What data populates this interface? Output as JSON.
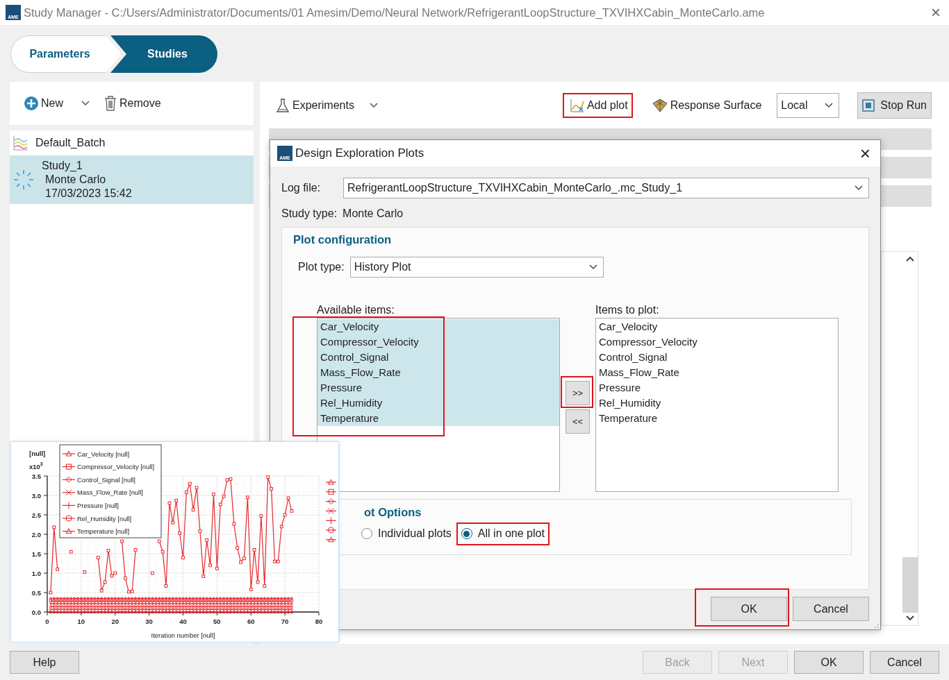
{
  "window": {
    "logo": "AME",
    "title": "Study Manager - C:/Users/Administrator/Documents/01 Amesim/Demo/Neural Network/RefrigerantLoopStructure_TXVIHXCabin_MonteCarlo.ame",
    "close": "×"
  },
  "breadcrumb": [
    {
      "label": "Parameters",
      "selected": false
    },
    {
      "label": "Studies",
      "selected": true
    }
  ],
  "left_toolbar": {
    "new": "New",
    "remove": "Remove"
  },
  "batch": {
    "name": "Default_Batch",
    "studies": [
      {
        "name": "Study_1",
        "type": "Monte Carlo",
        "date": "17/03/2023 15:42",
        "selected": true
      }
    ]
  },
  "right_toolbar": {
    "experiments": "Experiments",
    "add_plot": {
      "label": "Add plot",
      "highlighted": true
    },
    "response_surface": "Response Surface",
    "location": "Local",
    "stop_run": "Stop Run"
  },
  "dialog": {
    "logo": "AME",
    "title": "Design Exploration Plots",
    "close": "×",
    "log_file_label": "Log file:",
    "log_file": "RefrigerantLoopStructure_TXVIHXCabin_MonteCarlo_.mc_Study_1",
    "study_type_label": "Study type:",
    "study_type": "Monte Carlo",
    "plot_config_title": "Plot configuration",
    "plot_type_label": "Plot type:",
    "plot_type": "History Plot",
    "available_label": "Available items:",
    "available_highlighted": true,
    "available_items": [
      {
        "label": "Car_Velocity",
        "selected": true
      },
      {
        "label": "Compressor_Velocity",
        "selected": true
      },
      {
        "label": "Control_Signal",
        "selected": true
      },
      {
        "label": "Mass_Flow_Rate",
        "selected": true
      },
      {
        "label": "Pressure",
        "selected": true
      },
      {
        "label": "Rel_Humidity",
        "selected": true
      },
      {
        "label": "Temperature",
        "selected": true
      }
    ],
    "add_button": {
      "label": ">>",
      "highlighted": true
    },
    "remove_button": {
      "label": "<<"
    },
    "plot_label": "Items to plot:",
    "plot_items": [
      {
        "label": "Car_Velocity",
        "selected": false
      },
      {
        "label": "Compressor_Velocity",
        "selected": false
      },
      {
        "label": "Control_Signal",
        "selected": false
      },
      {
        "label": "Mass_Flow_Rate",
        "selected": false
      },
      {
        "label": "Pressure",
        "selected": false
      },
      {
        "label": "Rel_Humidity",
        "selected": false
      },
      {
        "label": "Temperature",
        "selected": false
      }
    ],
    "options_title": "ot Options",
    "options": [
      {
        "label": "Individual plots",
        "selected": false
      },
      {
        "label": "All in one plot",
        "selected": true,
        "highlighted": true
      }
    ],
    "ok": {
      "label": "OK",
      "highlighted": true
    },
    "cancel": {
      "label": "Cancel"
    }
  },
  "plot_preview": {
    "scale": "x10$^{3}$",
    "chart_data": {
      "type": "line",
      "grid": true,
      "legend": "upper left",
      "xlabel": "Iteration number [null]",
      "ylabel": "[null]",
      "xlim": [
        0,
        80
      ],
      "ylim": [
        0,
        3.5
      ],
      "xticks": [
        0,
        10,
        20,
        30,
        40,
        50,
        60,
        70,
        80
      ],
      "yticks": [
        {
          "value": 0,
          "label": "0.0"
        },
        {
          "value": 0.5,
          "label": "0.5"
        },
        {
          "value": 1,
          "label": "1.0"
        },
        {
          "value": 1.5,
          "label": "1.5"
        },
        {
          "value": 2,
          "label": "2.0"
        },
        {
          "value": 2.5,
          "label": "2.5"
        },
        {
          "value": 3,
          "label": "3.0"
        },
        {
          "value": 3.5,
          "label": "3.5"
        }
      ],
      "x": [
        1,
        2,
        3,
        4,
        5,
        6,
        7,
        8,
        9,
        10,
        11,
        12,
        13,
        14,
        15,
        16,
        17,
        18,
        19,
        20,
        21,
        22,
        23,
        24,
        25,
        26,
        27,
        28,
        29,
        30,
        31,
        32,
        33,
        34,
        35,
        36,
        37,
        38,
        39,
        40,
        41,
        42,
        43,
        44,
        45,
        46,
        47,
        48,
        49,
        50,
        51,
        52,
        53,
        54,
        55,
        56,
        57,
        58,
        59,
        60,
        61,
        62,
        63,
        64,
        65,
        66,
        67,
        68,
        69,
        70,
        71,
        72
      ],
      "series": [
        {
          "name": "Car_Velocity [null]",
          "color": "#e8262b",
          "marker": "triangle",
          "values": [
            0,
            0,
            0,
            0,
            0,
            0,
            0,
            0,
            0,
            0,
            0,
            0,
            0,
            0,
            0,
            0,
            0,
            0,
            0,
            0,
            0,
            0,
            0,
            0,
            0,
            0,
            0,
            0,
            0,
            0,
            0,
            0,
            0,
            0,
            0,
            0,
            0,
            0,
            0,
            0,
            0,
            0,
            0,
            0,
            0,
            0,
            0,
            0,
            0,
            0,
            0,
            0,
            0,
            0,
            0,
            0,
            0,
            0,
            0,
            0,
            0,
            0,
            0,
            0,
            0,
            0,
            0,
            0,
            0,
            0,
            0,
            0
          ]
        },
        {
          "name": "Compressor_Velocity [null]",
          "color": "#e8262b",
          "marker": "square",
          "values": [
            0.5,
            2.18,
            1.1,
            null,
            null,
            null,
            1.55,
            null,
            null,
            null,
            1.03,
            null,
            null,
            null,
            1.4,
            0.55,
            0.77,
            1.58,
            0.93,
            1.0,
            null,
            1.82,
            0.87,
            0.52,
            0.53,
            1.6,
            null,
            null,
            null,
            null,
            1.0,
            null,
            1.82,
            1.55,
            0.67,
            2.8,
            2.3,
            2.87,
            2.03,
            1.4,
            3.08,
            3.3,
            2.63,
            3.2,
            2.08,
            0.92,
            1.85,
            1.2,
            3.03,
            1.12,
            2.77,
            2.98,
            3.4,
            3.42,
            2.27,
            1.65,
            1.28,
            1.38,
            2.95,
            0.58,
            1.6,
            0.77,
            2.47,
            0.67,
            3.47,
            3.17,
            1.3,
            1.3,
            2.2,
            2.5,
            2.93,
            2.6
          ]
        },
        {
          "name": "Control_Signal [null]",
          "color": "#e8262b",
          "marker": "diamond",
          "values": [
            0.07,
            0.07,
            0.07,
            0.07,
            0.07,
            0.07,
            0.07,
            0.07,
            0.07,
            0.07,
            0.07,
            0.07,
            0.07,
            0.07,
            0.07,
            0.07,
            0.07,
            0.07,
            0.07,
            0.07,
            0.07,
            0.07,
            0.07,
            0.07,
            0.07,
            0.07,
            0.07,
            0.07,
            0.07,
            0.07,
            0.07,
            0.07,
            0.07,
            0.07,
            0.07,
            0.07,
            0.07,
            0.07,
            0.07,
            0.07,
            0.07,
            0.07,
            0.07,
            0.07,
            0.07,
            0.07,
            0.07,
            0.07,
            0.07,
            0.07,
            0.07,
            0.07,
            0.07,
            0.07,
            0.07,
            0.07,
            0.07,
            0.07,
            0.07,
            0.07,
            0.07,
            0.07,
            0.07,
            0.07,
            0.07,
            0.07,
            0.07,
            0.07,
            0.07,
            0.07,
            0.07,
            0.07
          ]
        },
        {
          "name": "Mass_Flow_Rate [null]",
          "color": "#e8262b",
          "marker": "cross",
          "values": [
            0.14,
            0.14,
            0.14,
            0.14,
            0.14,
            0.14,
            0.14,
            0.14,
            0.14,
            0.14,
            0.14,
            0.14,
            0.14,
            0.14,
            0.14,
            0.14,
            0.14,
            0.14,
            0.14,
            0.14,
            0.14,
            0.14,
            0.14,
            0.14,
            0.14,
            0.14,
            0.14,
            0.14,
            0.14,
            0.14,
            0.14,
            0.14,
            0.14,
            0.14,
            0.14,
            0.14,
            0.14,
            0.14,
            0.14,
            0.14,
            0.14,
            0.14,
            0.14,
            0.14,
            0.14,
            0.14,
            0.14,
            0.14,
            0.14,
            0.14,
            0.14,
            0.14,
            0.14,
            0.14,
            0.14,
            0.14,
            0.14,
            0.14,
            0.14,
            0.14,
            0.14,
            0.14,
            0.14,
            0.14,
            0.14,
            0.14,
            0.14,
            0.14,
            0.14,
            0.14,
            0.14,
            0.14
          ]
        },
        {
          "name": "Pressure [null]",
          "color": "#e8262b",
          "marker": "plus",
          "values": [
            0.21,
            0.21,
            0.21,
            0.21,
            0.21,
            0.21,
            0.21,
            0.21,
            0.21,
            0.21,
            0.21,
            0.21,
            0.21,
            0.21,
            0.21,
            0.21,
            0.21,
            0.21,
            0.21,
            0.21,
            0.21,
            0.21,
            0.21,
            0.21,
            0.21,
            0.21,
            0.21,
            0.21,
            0.21,
            0.21,
            0.21,
            0.21,
            0.21,
            0.21,
            0.21,
            0.21,
            0.21,
            0.21,
            0.21,
            0.21,
            0.21,
            0.21,
            0.21,
            0.21,
            0.21,
            0.21,
            0.21,
            0.21,
            0.21,
            0.21,
            0.21,
            0.21,
            0.21,
            0.21,
            0.21,
            0.21,
            0.21,
            0.21,
            0.21,
            0.21,
            0.21,
            0.21,
            0.21,
            0.21,
            0.21,
            0.21,
            0.21,
            0.21,
            0.21,
            0.21,
            0.21,
            0.21
          ]
        },
        {
          "name": "Rel_Humidity [null]",
          "color": "#e8262b",
          "marker": "circle",
          "values": [
            0.28,
            0.28,
            0.28,
            0.28,
            0.28,
            0.28,
            0.28,
            0.28,
            0.28,
            0.28,
            0.28,
            0.28,
            0.28,
            0.28,
            0.28,
            0.28,
            0.28,
            0.28,
            0.28,
            0.28,
            0.28,
            0.28,
            0.28,
            0.28,
            0.28,
            0.28,
            0.28,
            0.28,
            0.28,
            0.28,
            0.28,
            0.28,
            0.28,
            0.28,
            0.28,
            0.28,
            0.28,
            0.28,
            0.28,
            0.28,
            0.28,
            0.28,
            0.28,
            0.28,
            0.28,
            0.28,
            0.28,
            0.28,
            0.28,
            0.28,
            0.28,
            0.28,
            0.28,
            0.28,
            0.28,
            0.28,
            0.28,
            0.28,
            0.28,
            0.28,
            0.28,
            0.28,
            0.28,
            0.28,
            0.28,
            0.28,
            0.28,
            0.28,
            0.28,
            0.28,
            0.28,
            0.28
          ]
        },
        {
          "name": "Temperature [null]",
          "color": "#e8262b",
          "marker": "triangle",
          "values": [
            0.35,
            0.35,
            0.35,
            0.35,
            0.35,
            0.35,
            0.35,
            0.35,
            0.35,
            0.35,
            0.35,
            0.35,
            0.35,
            0.35,
            0.35,
            0.35,
            0.35,
            0.35,
            0.35,
            0.35,
            0.35,
            0.35,
            0.35,
            0.35,
            0.35,
            0.35,
            0.35,
            0.35,
            0.35,
            0.35,
            0.35,
            0.35,
            0.35,
            0.35,
            0.35,
            0.35,
            0.35,
            0.35,
            0.35,
            0.35,
            0.35,
            0.35,
            0.35,
            0.35,
            0.35,
            0.35,
            0.35,
            0.35,
            0.35,
            0.35,
            0.35,
            0.35,
            0.35,
            0.35,
            0.35,
            0.35,
            0.35,
            0.35,
            0.35,
            0.35,
            0.35,
            0.35,
            0.35,
            0.35,
            0.35,
            0.35,
            0.35,
            0.35,
            0.35,
            0.35,
            0.35,
            0.35
          ]
        }
      ]
    }
  },
  "footer": {
    "help": {
      "label": "Help",
      "disabled": false
    },
    "buttons": [
      {
        "label": "Back",
        "disabled": true
      },
      {
        "label": "Next",
        "disabled": true
      },
      {
        "label": "OK",
        "disabled": false
      },
      {
        "label": "Cancel",
        "disabled": false
      }
    ]
  }
}
